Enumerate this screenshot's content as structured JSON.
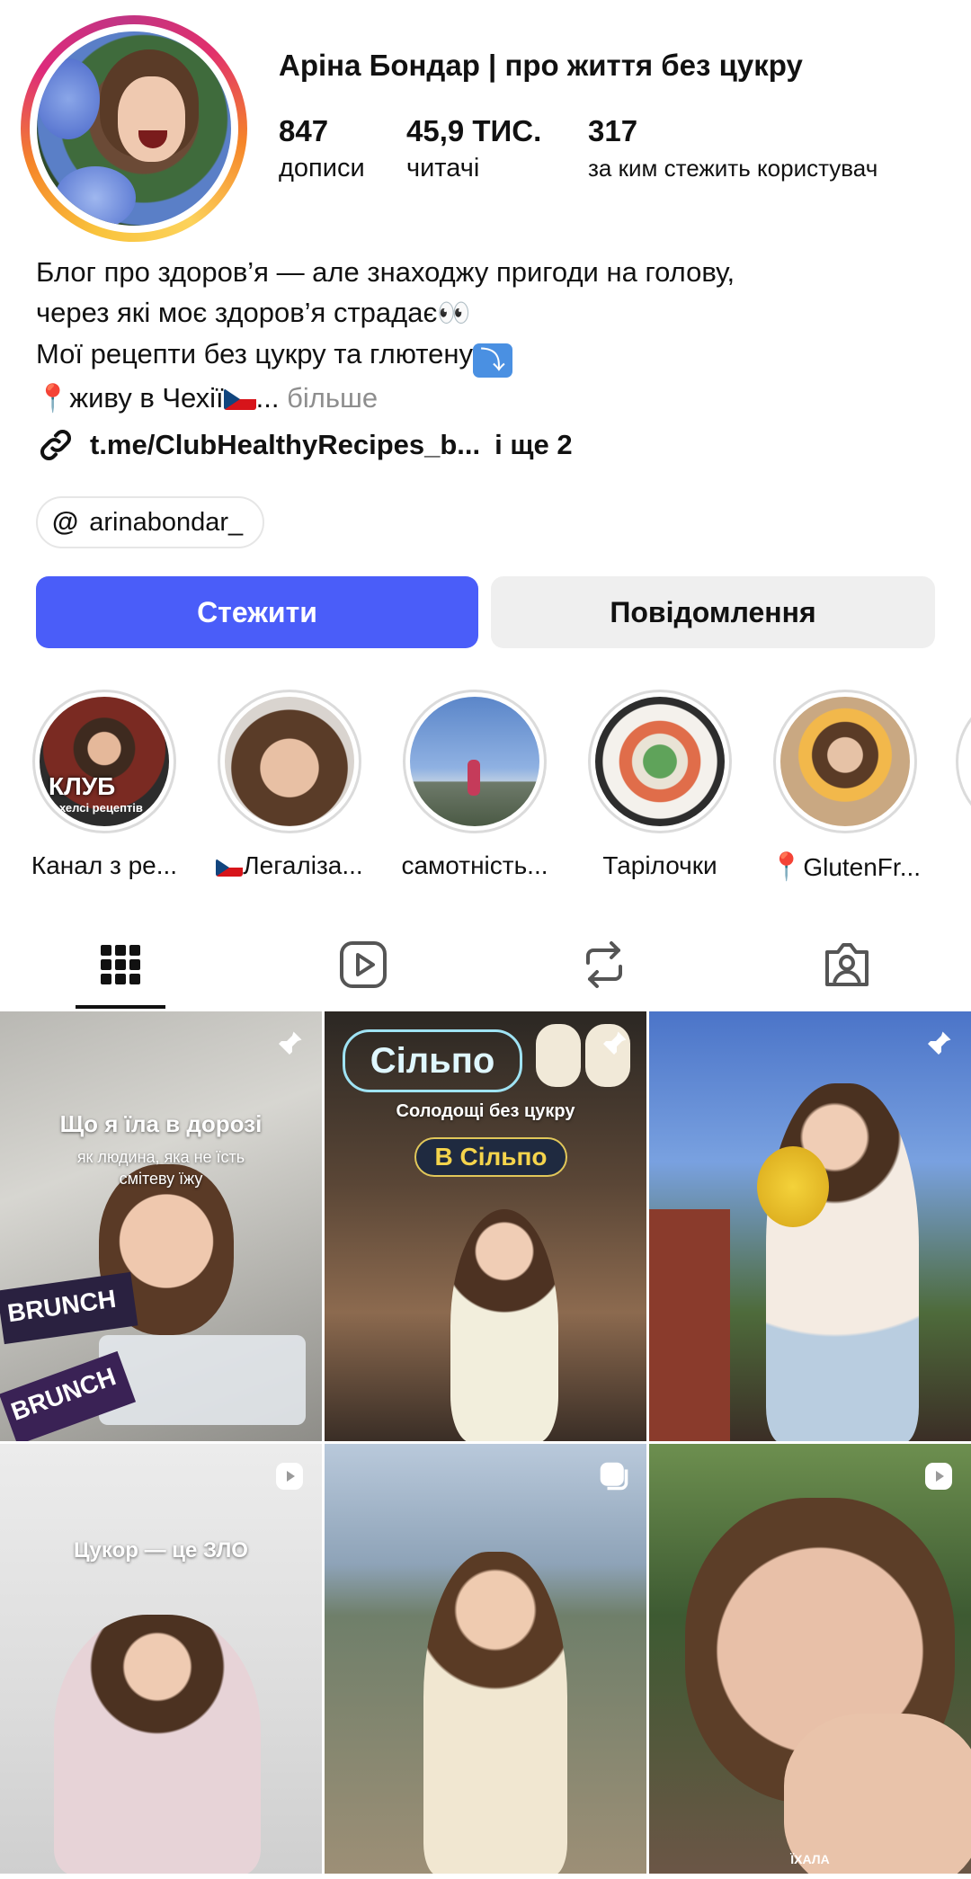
{
  "profile": {
    "username": "Аріна Бондар | про життя без цукру",
    "stats": [
      {
        "value": "847",
        "label": "дописи"
      },
      {
        "value": "45,9 ТИС.",
        "label": "читачі"
      },
      {
        "value": "317",
        "label": "за ким стежить користувач"
      }
    ],
    "bio": {
      "line1": "Блог про здоров’я — але знаходжу пригоди на голову,",
      "line2": "через які моє здоров’я страдає",
      "line3": "Мої рецепти без цукру та глютену",
      "line4": "живу в Чехії",
      "ellipsis": "...",
      "more": "більше"
    },
    "link": {
      "url": "t.me/ClubHealthyRecipes_b...",
      "extra": "і ще 2"
    },
    "threads_handle": "arinabondar_"
  },
  "actions": {
    "follow": "Стежити",
    "message": "Повідомлення"
  },
  "highlights": [
    {
      "label": "Канал з ре...",
      "overlay": "КЛУБ",
      "overlay_sub": "хелсі рецептів"
    },
    {
      "label": "Легаліза..."
    },
    {
      "label": "самотність..."
    },
    {
      "label": "Тарілочки"
    },
    {
      "label": "GlutenFr..."
    }
  ],
  "tabs": [
    {
      "icon": "grid-icon",
      "active": true
    },
    {
      "icon": "reels-icon",
      "active": false
    },
    {
      "icon": "reposts-icon",
      "active": false
    },
    {
      "icon": "tagged-icon",
      "active": false
    }
  ],
  "posts": [
    {
      "badge": "pin-icon",
      "caption": "Що я їла в дорозі",
      "subcaption": "як людина, яка не їсть смітеву їжу",
      "brand1": "BRUNCH",
      "brand2": "BRUNCH"
    },
    {
      "badge": "pin-icon",
      "sign": "Сільпо",
      "caption": "Солодощі без цукру",
      "logo": "В Сільпо"
    },
    {
      "badge": "pin-icon"
    },
    {
      "badge": "reel-icon",
      "caption": "Цукор — це ЗЛО"
    },
    {
      "badge": "carousel-icon"
    },
    {
      "badge": "reel-icon",
      "tiny": "ЇХАЛА"
    }
  ],
  "colors": {
    "follow_button": "#4a5df9",
    "message_button": "#efefef",
    "link": "#111111",
    "more_text": "#8e8e8e"
  }
}
